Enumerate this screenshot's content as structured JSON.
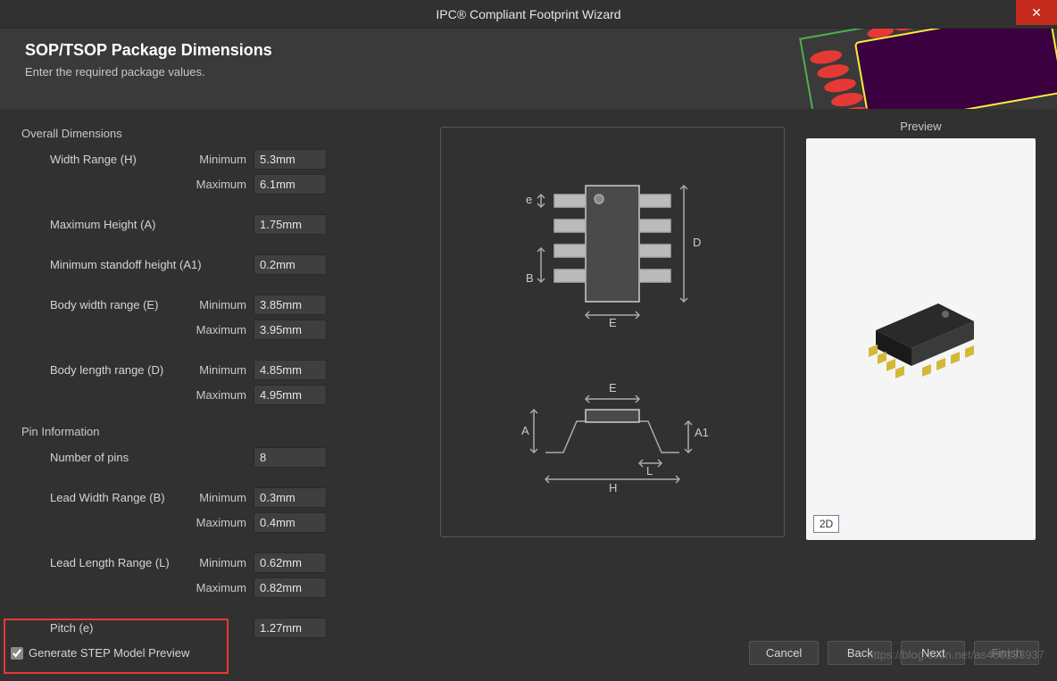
{
  "window": {
    "title": "IPC® Compliant Footprint Wizard"
  },
  "header": {
    "title": "SOP/TSOP Package Dimensions",
    "subtitle": "Enter the required package values."
  },
  "sections": {
    "overall": "Overall Dimensions",
    "pin": "Pin Information"
  },
  "labels": {
    "width_range": "Width Range (H)",
    "max_height": "Maximum Height (A)",
    "min_standoff": "Minimum standoff height (A1)",
    "body_width": "Body width range (E)",
    "body_length": "Body length range (D)",
    "num_pins": "Number of pins",
    "lead_width": "Lead Width Range (B)",
    "lead_length": "Lead Length Range (L)",
    "pitch": "Pitch (e)",
    "minimum": "Minimum",
    "maximum": "Maximum"
  },
  "values": {
    "width_min": "5.3mm",
    "width_max": "6.1mm",
    "max_height": "1.75mm",
    "min_standoff": "0.2mm",
    "body_width_min": "3.85mm",
    "body_width_max": "3.95mm",
    "body_length_min": "4.85mm",
    "body_length_max": "4.95mm",
    "num_pins": "8",
    "lead_width_min": "0.3mm",
    "lead_width_max": "0.4mm",
    "lead_length_min": "0.62mm",
    "lead_length_max": "0.82mm",
    "pitch": "1.27mm"
  },
  "diagram": {
    "e": "e",
    "B": "B",
    "D": "D",
    "E": "E",
    "A": "A",
    "A1": "A1",
    "L": "L",
    "H": "H"
  },
  "preview": {
    "title": "Preview",
    "mode": "2D"
  },
  "checkbox": {
    "generate_step": "Generate STEP Model Preview"
  },
  "buttons": {
    "cancel": "Cancel",
    "back": "Back",
    "next": "Next",
    "finish": "Finish"
  },
  "watermark": "https://blog.csdn.net/as480133937"
}
